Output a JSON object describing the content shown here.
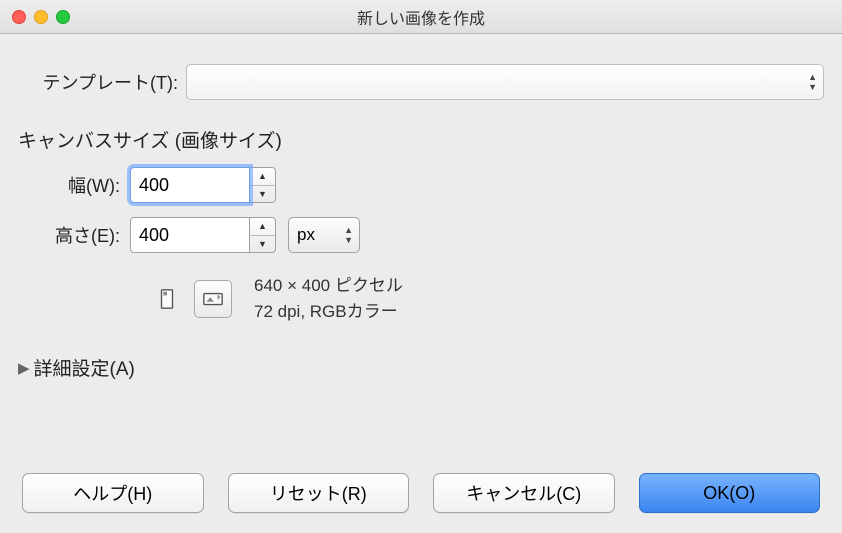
{
  "window": {
    "title": "新しい画像を作成"
  },
  "template": {
    "label": "テンプレート(T):",
    "value": ""
  },
  "canvas": {
    "section_title": "キャンバスサイズ (画像サイズ)",
    "width_label": "幅(W):",
    "width_value": "400",
    "height_label": "高さ(E):",
    "height_value": "400",
    "unit": "px",
    "info_line1": "640 × 400 ピクセル",
    "info_line2": "72 dpi, RGBカラー"
  },
  "advanced": {
    "label": "詳細設定(A)"
  },
  "buttons": {
    "help": "ヘルプ(H)",
    "reset": "リセット(R)",
    "cancel": "キャンセル(C)",
    "ok": "OK(O)"
  }
}
